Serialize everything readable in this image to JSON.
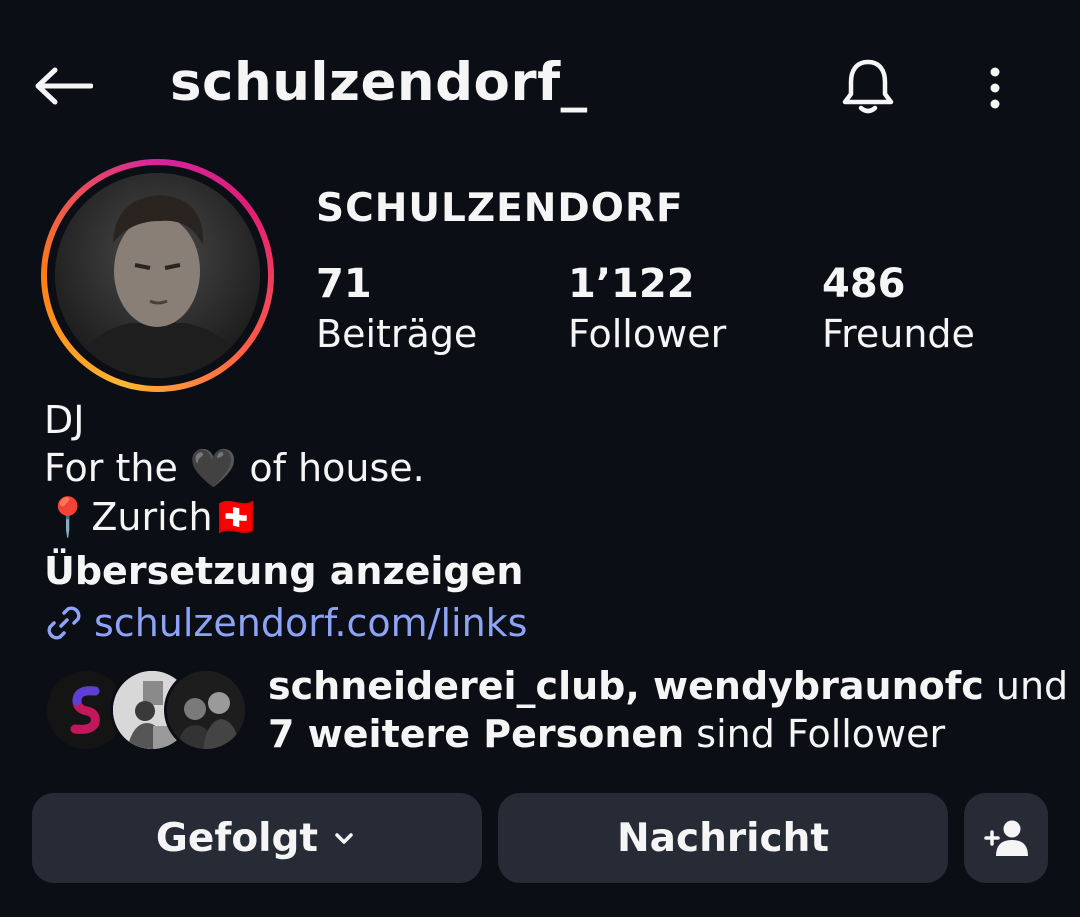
{
  "header": {
    "username": "schulzendorf_",
    "back_icon": "arrow-left-icon",
    "bell_icon": "bell-icon",
    "more_icon": "more-vertical-icon"
  },
  "profile": {
    "display_name": "SCHULZENDORF",
    "ring_colors": [
      "#d6249f",
      "#fd5949",
      "#fdb633"
    ],
    "stats": [
      {
        "value": "71",
        "label": "Beiträge"
      },
      {
        "value": "1’122",
        "label": "Follower"
      },
      {
        "value": "486",
        "label": "Freunde"
      }
    ]
  },
  "bio": {
    "category": "DJ",
    "text_pre": "For the",
    "heart": "🖤",
    "text_post": "of house.",
    "location_pin": "📍",
    "location": "Zurich",
    "flag": "🇨🇭",
    "translate": "Übersetzung anzeigen",
    "website": "schulzendorf.com/links",
    "link_color": "#8ea3f5"
  },
  "mutual": {
    "names": "schneiderei_club, wendybraunofc",
    "and": " und",
    "others": "7 weitere Personen",
    "suffix": " sind Follower"
  },
  "actions": {
    "follow_label": "Gefolgt",
    "message_label": "Nachricht",
    "add_user_icon": "add-user-icon"
  }
}
